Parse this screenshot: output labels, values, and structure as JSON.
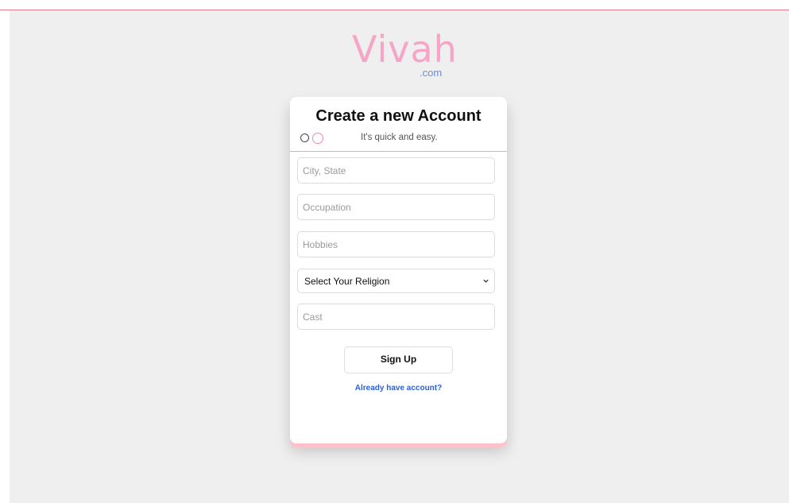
{
  "brand": {
    "name": "Vivah",
    "suffix": ".com",
    "primary_color": "#f6a5c6",
    "suffix_color": "#6b8dd6"
  },
  "card": {
    "title": "Create a new Account",
    "subtitle": "It's quick and easy.",
    "accent_color": "#ffc2c9"
  },
  "form": {
    "city_placeholder": "City, State",
    "occupation_placeholder": "Occupation",
    "hobbies_placeholder": "Hobbies",
    "religion_selected": "Select Your Religion",
    "cast_placeholder": "Cast",
    "signup_label": "Sign Up",
    "login_link": "Already have account?",
    "link_color": "#2b5fd9"
  }
}
